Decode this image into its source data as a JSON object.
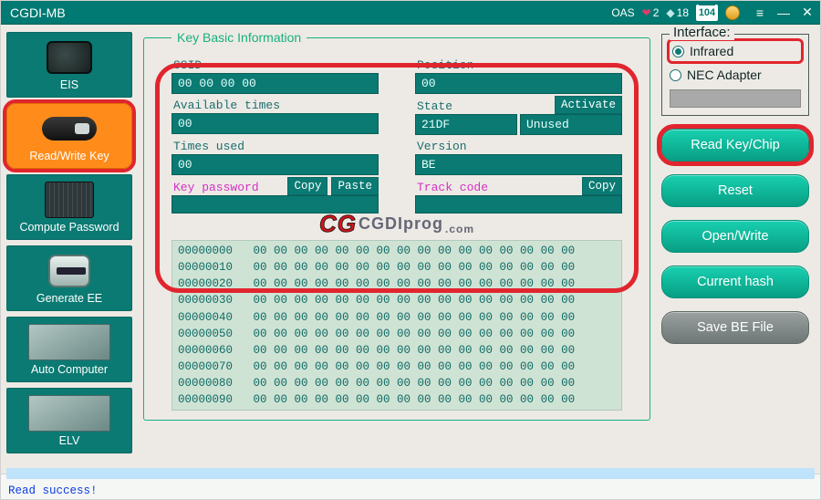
{
  "title": "CGDI-MB",
  "header": {
    "oas": "OAS",
    "rubies": "2",
    "diamonds": "18",
    "calendar": "104"
  },
  "sidebar": [
    {
      "id": "eis",
      "label": "EIS",
      "active": false
    },
    {
      "id": "rwkey",
      "label": "Read/Write Key",
      "active": true
    },
    {
      "id": "comppw",
      "label": "Compute Password",
      "active": false
    },
    {
      "id": "genee",
      "label": "Generate EE",
      "active": false
    },
    {
      "id": "autocomp",
      "label": "Auto Computer",
      "active": false
    },
    {
      "id": "elv",
      "label": "ELV",
      "active": false
    }
  ],
  "kbi": {
    "legend": "Key Basic Information",
    "ssid_label": "SSID",
    "ssid_value": "00 00 00 00",
    "position_label": "Position",
    "position_value": "00",
    "avail_label": "Available times",
    "avail_value": "00",
    "state_label": "State",
    "state_value": "21DF",
    "state_status": "Unused",
    "activate_btn": "Activate",
    "times_label": "Times used",
    "times_value": "00",
    "version_label": "Version",
    "version_value": "BE",
    "keypw_label": "Key password",
    "keypw_value": "",
    "copy_btn": "Copy",
    "paste_btn": "Paste",
    "track_label": "Track code",
    "track_value": "",
    "track_copy": "Copy"
  },
  "watermark": {
    "c1": "CG",
    "c2": "CGDIprog",
    "dotcom": ".com"
  },
  "hex": {
    "addresses": [
      "00000000",
      "00000010",
      "00000020",
      "00000030",
      "00000040",
      "00000050",
      "00000060",
      "00000070",
      "00000080",
      "00000090"
    ],
    "row": "00 00 00 00 00 00 00 00 00 00 00 00 00 00 00 00"
  },
  "interface": {
    "title": "Interface:",
    "opt1": "Infrared",
    "opt2": "NEC Adapter",
    "selected": "opt1"
  },
  "buttons": {
    "read": "Read Key/Chip",
    "reset": "Reset",
    "openwrite": "Open/Write",
    "hash": "Current hash",
    "save": "Save BE File"
  },
  "status": "Read success!"
}
